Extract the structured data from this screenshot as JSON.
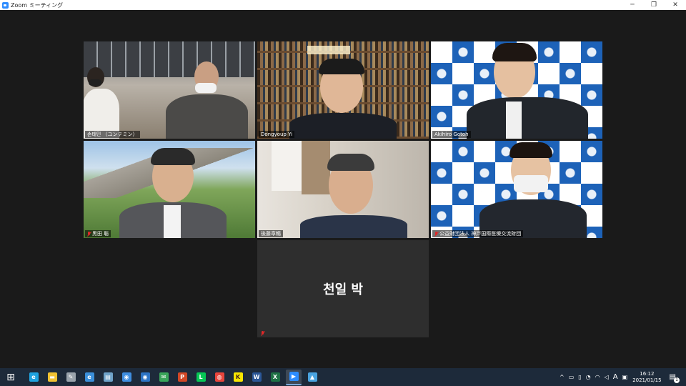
{
  "window": {
    "title": "Zoom ミーティング",
    "controls": {
      "minimize": "─",
      "restore": "❐",
      "close": "✕"
    }
  },
  "participants": [
    {
      "name": "손태민 （ユンテミン）",
      "muted": false
    },
    {
      "name": "Dongyoup Yi",
      "muted": false
    },
    {
      "name": "Akihiro Gotoh",
      "muted": false,
      "active_speaker": true
    },
    {
      "name": "黒田 聡",
      "muted": true
    },
    {
      "name": "後藤章暢",
      "muted": false
    },
    {
      "name": "公益財団法人 神戸国際医療交流財団",
      "muted": true
    },
    {
      "name": "천일 박",
      "muted": true,
      "video": false
    }
  ],
  "backdrop": {
    "brand_text": "Kobe IMA"
  },
  "taskbar": {
    "apps": [
      {
        "name": "start-icon",
        "glyph": "⊞"
      },
      {
        "name": "edge-icon",
        "glyph": "e",
        "color": "#1fa3e0"
      },
      {
        "name": "file-explorer-icon",
        "glyph": "▬",
        "color": "#f1c232"
      },
      {
        "name": "feather-icon",
        "glyph": "✎",
        "color": "#9aa4ad"
      },
      {
        "name": "ie-icon",
        "glyph": "e",
        "color": "#3b8fd9"
      },
      {
        "name": "notepad-icon",
        "glyph": "▤",
        "color": "#6fa3c9"
      },
      {
        "name": "app-blue-icon",
        "glyph": "◉",
        "color": "#3f8ee0"
      },
      {
        "name": "app-blue2-icon",
        "glyph": "◉",
        "color": "#2d74c4"
      },
      {
        "name": "mail-icon",
        "glyph": "✉",
        "color": "#3aa65a"
      },
      {
        "name": "powerpoint-icon",
        "glyph": "P",
        "color": "#d24726"
      },
      {
        "name": "line-icon",
        "glyph": "L",
        "color": "#06c755"
      },
      {
        "name": "chrome-icon",
        "glyph": "◍",
        "color": "#e8453c"
      },
      {
        "name": "kakaotalk-icon",
        "glyph": "K",
        "color": "#f7e600"
      },
      {
        "name": "word-icon",
        "glyph": "W",
        "color": "#2b5797"
      },
      {
        "name": "excel-icon",
        "glyph": "X",
        "color": "#1e7145"
      },
      {
        "name": "zoom-icon",
        "glyph": "▶",
        "color": "#2d8cff",
        "active": true
      },
      {
        "name": "photos-icon",
        "glyph": "▲",
        "color": "#4aa3df"
      }
    ],
    "tray": {
      "chevron": "^",
      "ime": "A",
      "time": "16:12",
      "date": "2021/01/15",
      "notifications": "1"
    }
  }
}
